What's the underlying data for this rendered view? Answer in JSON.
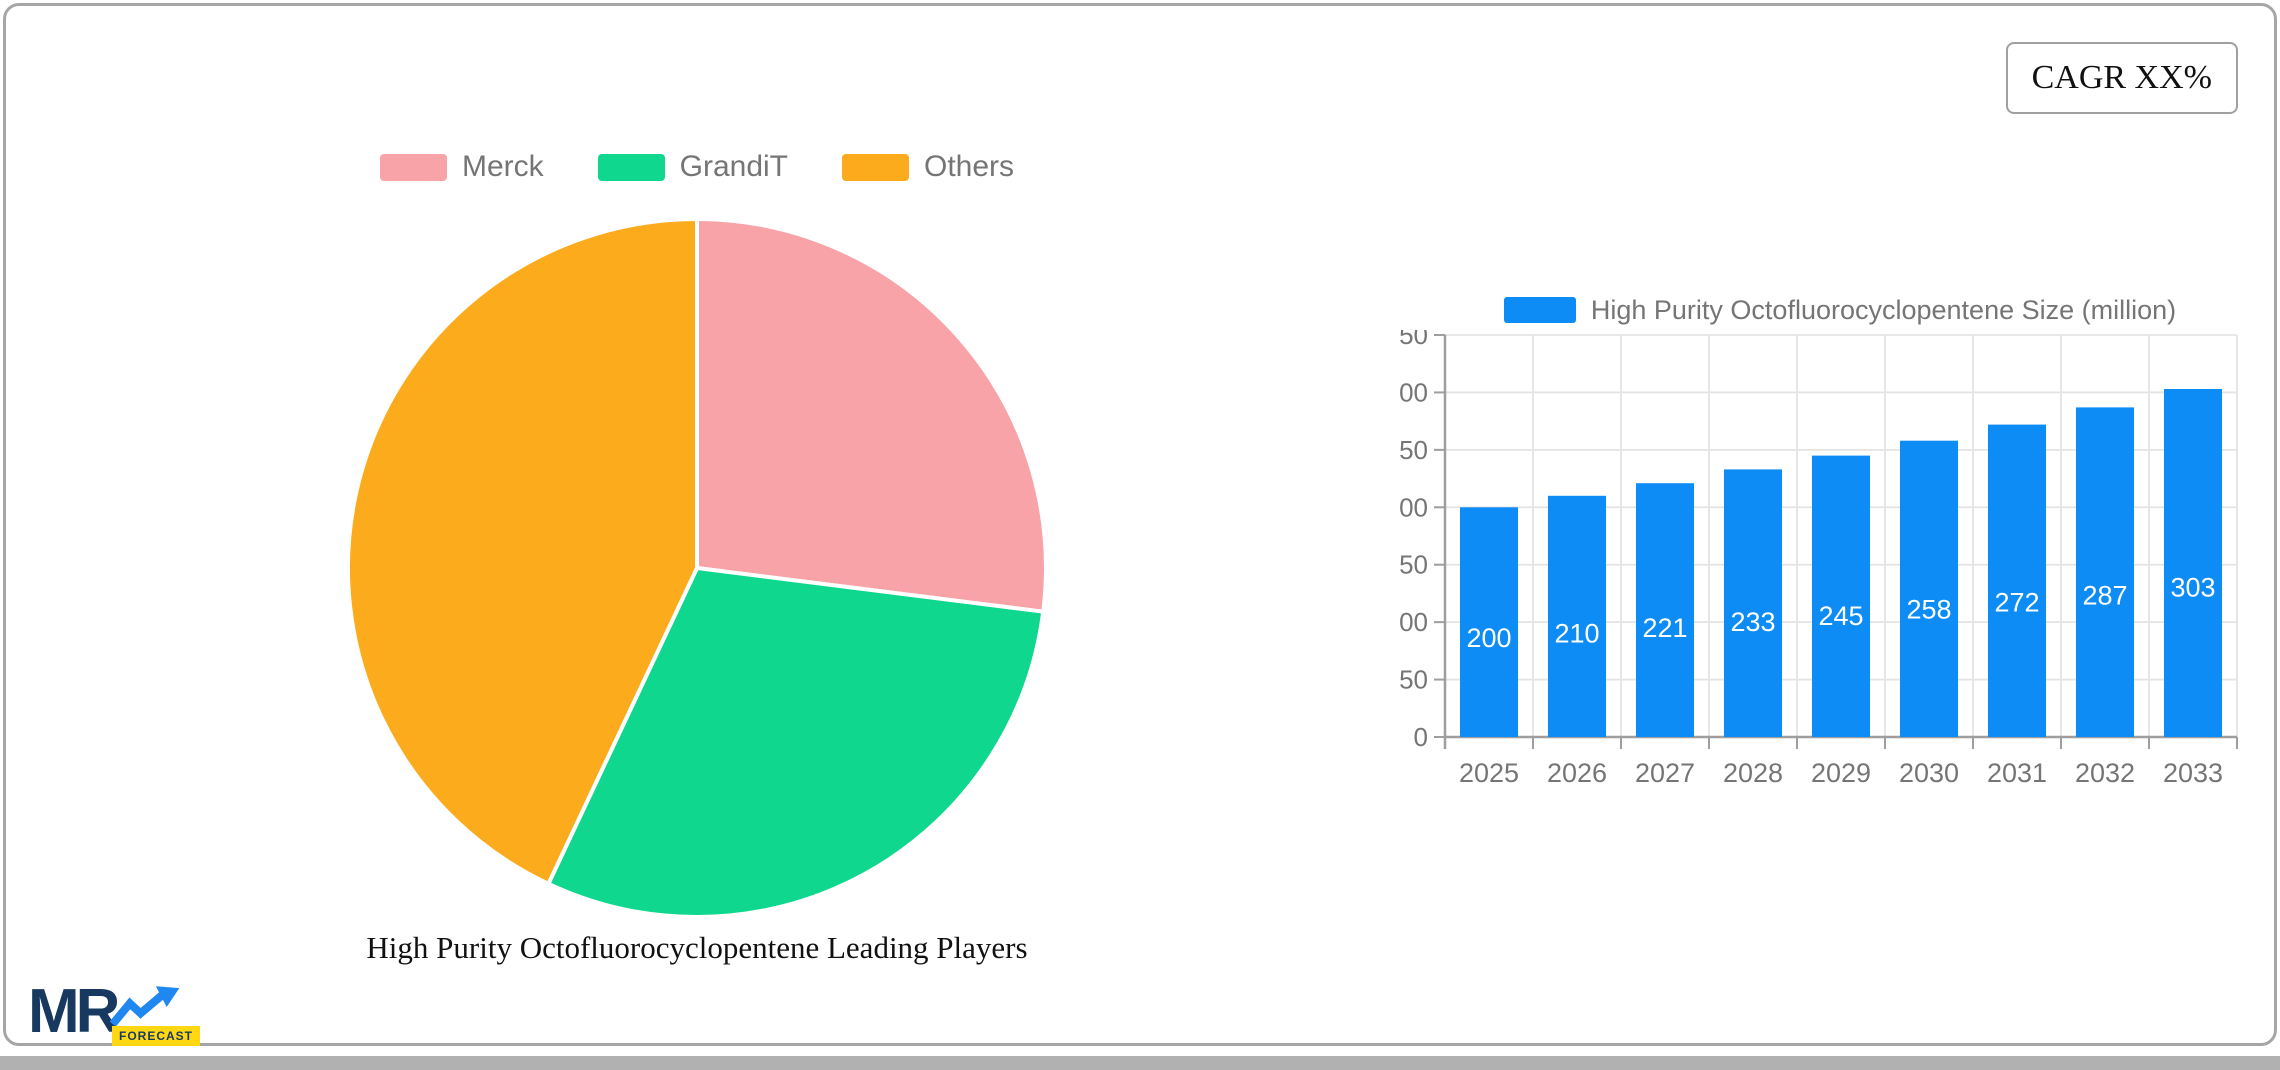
{
  "frame": {
    "cagr_label": "CAGR XX%"
  },
  "pie_section": {
    "caption": "High Purity Octofluorocyclopentene Leading Players"
  },
  "bar_section": {
    "legend_label": "High Purity Octofluorocyclopentene Size (million)"
  },
  "logo": {
    "mr": "MR",
    "forecast": "FORECAST"
  },
  "colors": {
    "pie_pink": "#f7a3a7",
    "pie_green": "#10d78e",
    "pie_orange": "#fbab1b",
    "bar_blue": "#0e8cf5",
    "axis": "#9e9e9e",
    "gridline": "#e4e4e4",
    "tick_text": "#757575"
  },
  "chart_data": [
    {
      "type": "pie",
      "title": "High Purity Octofluorocyclopentene Leading Players",
      "labels": [
        "Merck",
        "GrandiT",
        "Others"
      ],
      "values": [
        27,
        30,
        43
      ],
      "colors": [
        "#f7a3a7",
        "#10d78e",
        "#fbab1b"
      ],
      "legend_position": "top",
      "start_angle_deg": 0,
      "note": "values are percent shares estimated from slice angles; no numeric labels shown on chart"
    },
    {
      "type": "bar",
      "title": "High Purity Octofluorocyclopentene Size (million)",
      "categories": [
        "2025",
        "2026",
        "2027",
        "2028",
        "2029",
        "2030",
        "2031",
        "2032",
        "2033"
      ],
      "values": [
        200,
        210,
        221,
        233,
        245,
        258,
        272,
        287,
        303
      ],
      "bar_color": "#0e8cf5",
      "value_label_color": "#ffffff",
      "xlabel": "",
      "ylabel": "",
      "ylim": [
        0,
        350
      ],
      "ytick_step": 50,
      "grid": true,
      "legend_position": "top"
    }
  ]
}
